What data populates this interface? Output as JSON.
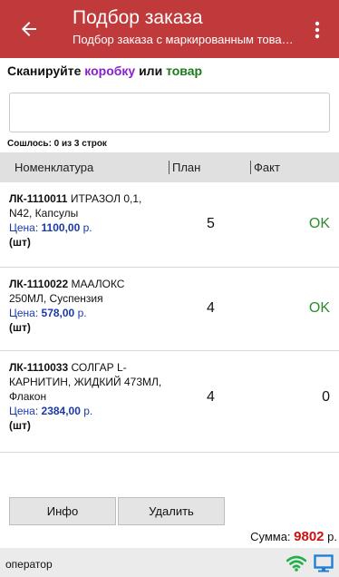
{
  "header": {
    "title": "Подбор заказа",
    "subtitle": "Подбор заказа с маркированным товаром"
  },
  "prompt": {
    "prefix": "Сканируйте ",
    "box": "коробку",
    "middle": " или ",
    "item": "товар"
  },
  "scan": {
    "value": ""
  },
  "matched": "Сошлось: 0 из 3 строк",
  "table": {
    "headers": [
      "Номенклатура",
      "План",
      "Факт"
    ],
    "price_label": "Цена: ",
    "currency": " р.",
    "rows": [
      {
        "code": "ЛК-1110011",
        "name": " ИТРАЗОЛ 0,1, N42, Капсулы",
        "price": "1100,00",
        "unit": "(шт)",
        "plan": "5",
        "fact": "OK"
      },
      {
        "code": "ЛК-1110022",
        "name": " МААЛОКС 250МЛ, Суспензия",
        "price": "578,00",
        "unit": "(шт)",
        "plan": "4",
        "fact": "OK"
      },
      {
        "code": "ЛК-1110033",
        "name": " СОЛГАР L-КАРНИТИН, ЖИДКИЙ 473МЛ, Флакон",
        "price": "2384,00",
        "unit": "(шт)",
        "plan": "4",
        "fact": "0"
      }
    ]
  },
  "buttons": {
    "info": "Инфо",
    "delete": "Удалить"
  },
  "sum": {
    "label": "Сумма: ",
    "value": "9802",
    "currency": " р."
  },
  "status": {
    "user": "оператор"
  },
  "colors": {
    "appbar": "#c0393b",
    "ok": "#2e8b2e",
    "sum": "#cc1111",
    "wifi": "#22b04b",
    "monitor": "#1e7fd8"
  }
}
